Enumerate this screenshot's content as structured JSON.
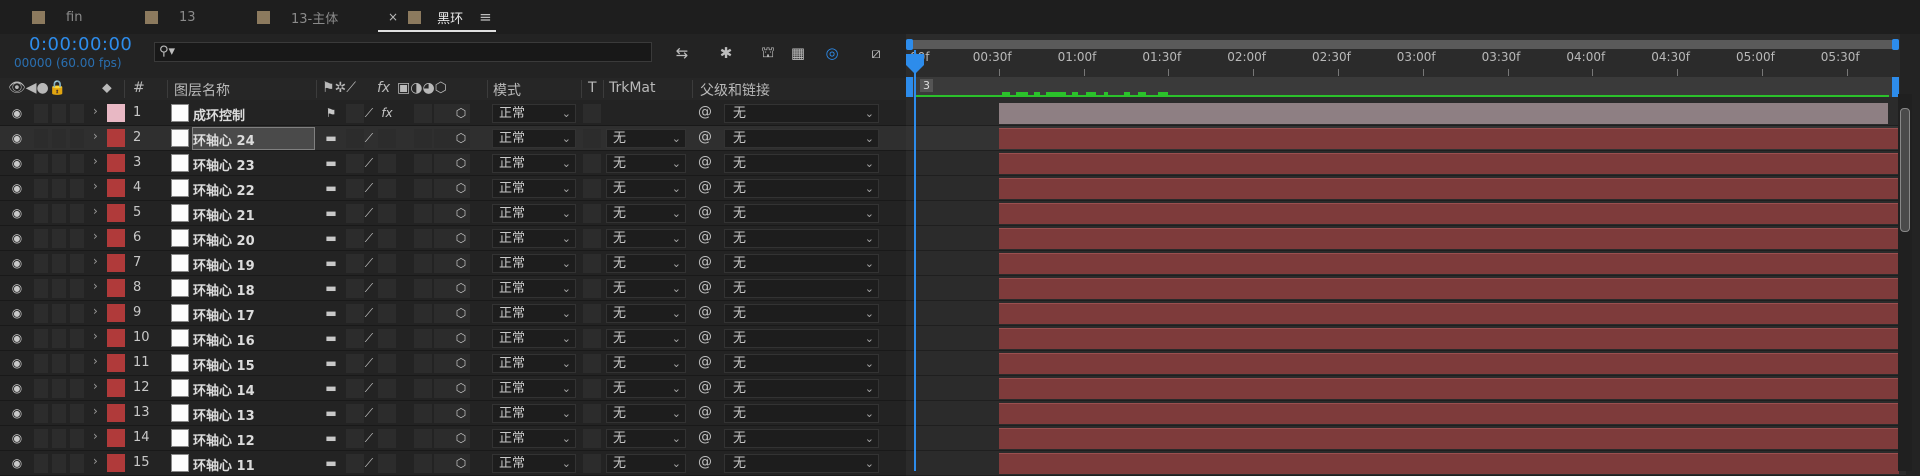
{
  "tabs": [
    {
      "label": "fin",
      "color": "#8c7a5e"
    },
    {
      "label": "13",
      "color": "#8c7a5e"
    },
    {
      "label": "13-主体",
      "color": "#8c7a5e"
    },
    {
      "label": "黑环",
      "color": "#8c7a5e",
      "active": true,
      "close": "×",
      "menu": "≡"
    }
  ],
  "timecode": "0:00:00:00",
  "fps_info": "00000 (60.00 fps)",
  "search": {
    "placeholder": "",
    "icon": "search-icon"
  },
  "toolbar_icons": [
    "comp-flowchart-icon",
    "draft-3d-icon",
    "shy-layers-icon",
    "frame-blending-icon",
    "motion-blur-icon",
    "graph-editor-icon"
  ],
  "columns": {
    "layer_name": "图层名称",
    "number": "#",
    "switches_fx": "fx",
    "mode": "模式",
    "t": "T",
    "trkmat": "TrkMat",
    "parent": "父级和链接"
  },
  "ruler": {
    "labels": [
      "00f",
      "00:30f",
      "01:00f",
      "01:30f",
      "02:00f",
      "02:30f",
      "03:00f",
      "03:30f",
      "04:00f",
      "04:30f",
      "05:00f",
      "05:30f"
    ]
  },
  "workarea_marker": "3",
  "layers": [
    {
      "num": "1",
      "name": "成环控制",
      "label_color": "#e8b8c4",
      "mode": "正常",
      "trkmat": "",
      "parent": "无",
      "has_fx": true,
      "bar": "pink"
    },
    {
      "num": "2",
      "name": "环轴心 24",
      "label_color": "#b03a3a",
      "mode": "正常",
      "trkmat": "无",
      "parent": "无",
      "selected": true,
      "bar": "red"
    },
    {
      "num": "3",
      "name": "环轴心 23",
      "label_color": "#b03a3a",
      "mode": "正常",
      "trkmat": "无",
      "parent": "无",
      "bar": "red"
    },
    {
      "num": "4",
      "name": "环轴心 22",
      "label_color": "#b03a3a",
      "mode": "正常",
      "trkmat": "无",
      "parent": "无",
      "bar": "red"
    },
    {
      "num": "5",
      "name": "环轴心 21",
      "label_color": "#b03a3a",
      "mode": "正常",
      "trkmat": "无",
      "parent": "无",
      "bar": "red"
    },
    {
      "num": "6",
      "name": "环轴心 20",
      "label_color": "#b03a3a",
      "mode": "正常",
      "trkmat": "无",
      "parent": "无",
      "bar": "red"
    },
    {
      "num": "7",
      "name": "环轴心 19",
      "label_color": "#b03a3a",
      "mode": "正常",
      "trkmat": "无",
      "parent": "无",
      "bar": "red"
    },
    {
      "num": "8",
      "name": "环轴心 18",
      "label_color": "#b03a3a",
      "mode": "正常",
      "trkmat": "无",
      "parent": "无",
      "bar": "red"
    },
    {
      "num": "9",
      "name": "环轴心 17",
      "label_color": "#b03a3a",
      "mode": "正常",
      "trkmat": "无",
      "parent": "无",
      "bar": "red"
    },
    {
      "num": "10",
      "name": "环轴心 16",
      "label_color": "#b03a3a",
      "mode": "正常",
      "trkmat": "无",
      "parent": "无",
      "bar": "red"
    },
    {
      "num": "11",
      "name": "环轴心 15",
      "label_color": "#b03a3a",
      "mode": "正常",
      "trkmat": "无",
      "parent": "无",
      "bar": "red"
    },
    {
      "num": "12",
      "name": "环轴心 14",
      "label_color": "#b03a3a",
      "mode": "正常",
      "trkmat": "无",
      "parent": "无",
      "bar": "red"
    },
    {
      "num": "13",
      "name": "环轴心 13",
      "label_color": "#b03a3a",
      "mode": "正常",
      "trkmat": "无",
      "parent": "无",
      "bar": "red"
    },
    {
      "num": "14",
      "name": "环轴心 12",
      "label_color": "#b03a3a",
      "mode": "正常",
      "trkmat": "无",
      "parent": "无",
      "bar": "red"
    },
    {
      "num": "15",
      "name": "环轴心 11",
      "label_color": "#b03a3a",
      "mode": "正常",
      "trkmat": "无",
      "parent": "无",
      "bar": "red"
    }
  ],
  "colors": {
    "accent": "#2d8ceb",
    "workarea": "#2bc02b",
    "layer_bar_red": "#7e3b3b",
    "layer_bar_pink": "#8e7f83"
  }
}
